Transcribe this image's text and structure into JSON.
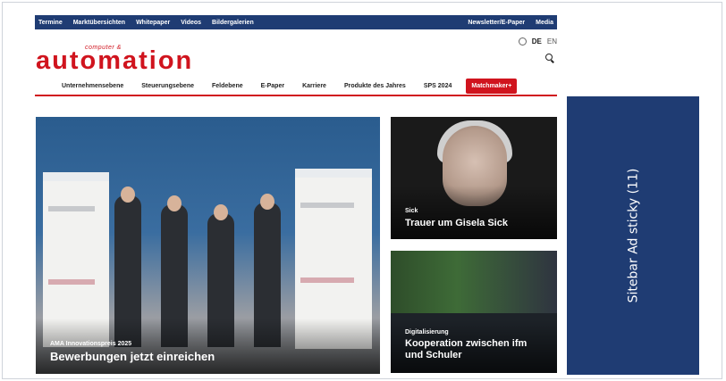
{
  "topbar": {
    "left_links": [
      "Termine",
      "Marktübersichten",
      "Whitepaper",
      "Videos",
      "Bildergalerien"
    ],
    "right_links": [
      "Newsletter/E-Paper",
      "Media"
    ]
  },
  "lang": {
    "active": "DE",
    "other": "EN",
    "icon": "globe-icon"
  },
  "brand": {
    "small": "computer &",
    "name": "automation",
    "color": "#d0141e"
  },
  "search": {
    "icon": "search-icon",
    "placeholder": ""
  },
  "nav": {
    "items": [
      "Unternehmensebene",
      "Steuerungsebene",
      "Feldebene",
      "E-Paper",
      "Karriere",
      "Produkte des Jahres",
      "SPS 2024"
    ],
    "cta": "Matchmaker+"
  },
  "hero": {
    "kicker": "AMA Innovationspreis 2025",
    "title": "Bewerbungen jetzt einreichen"
  },
  "card1": {
    "kicker": "Sick",
    "title": "Trauer um Gisela Sick"
  },
  "card2": {
    "kicker": "Digitalisierung",
    "title_line1": "Kooperation zwischen ifm",
    "title_line2": "und Schuler"
  },
  "sidebar_ad": {
    "label": "Sitebar Ad sticky (11)",
    "color": "#1f3c73"
  }
}
